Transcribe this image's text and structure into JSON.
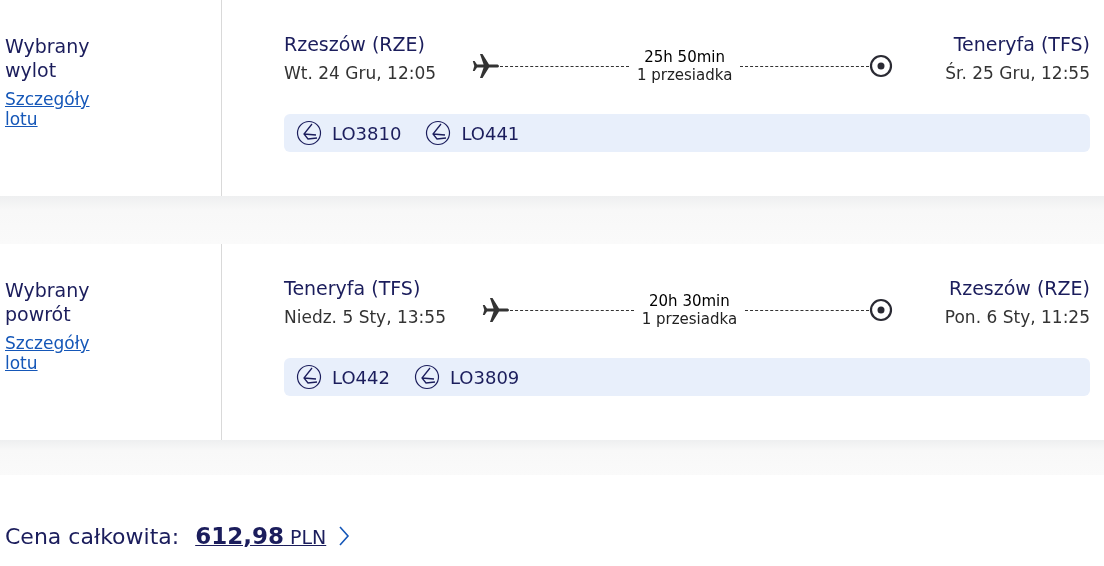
{
  "flights": [
    {
      "label": "Wybrany wylot",
      "details_link": "Szczegóły lotu",
      "origin": "Rzeszów (RZE)",
      "departure": "Wt. 24 Gru, 12:05",
      "duration": "25h 50min",
      "stops": "1 przesiadka",
      "destination": "Teneryfa (TFS)",
      "arrival": "Śr. 25 Gru, 12:55",
      "flight_numbers": [
        "LO3810",
        "LO441"
      ]
    },
    {
      "label": "Wybrany powrót",
      "details_link": "Szczegóły lotu",
      "origin": "Teneryfa (TFS)",
      "departure": "Niedz. 5 Sty, 13:55",
      "duration": "20h 30min",
      "stops": "1 przesiadka",
      "destination": "Rzeszów (RZE)",
      "arrival": "Pon. 6 Sty, 11:25",
      "flight_numbers": [
        "LO442",
        "LO3809"
      ]
    }
  ],
  "total": {
    "label": "Cena całkowita:",
    "price": "**612,98** PLN"
  }
}
